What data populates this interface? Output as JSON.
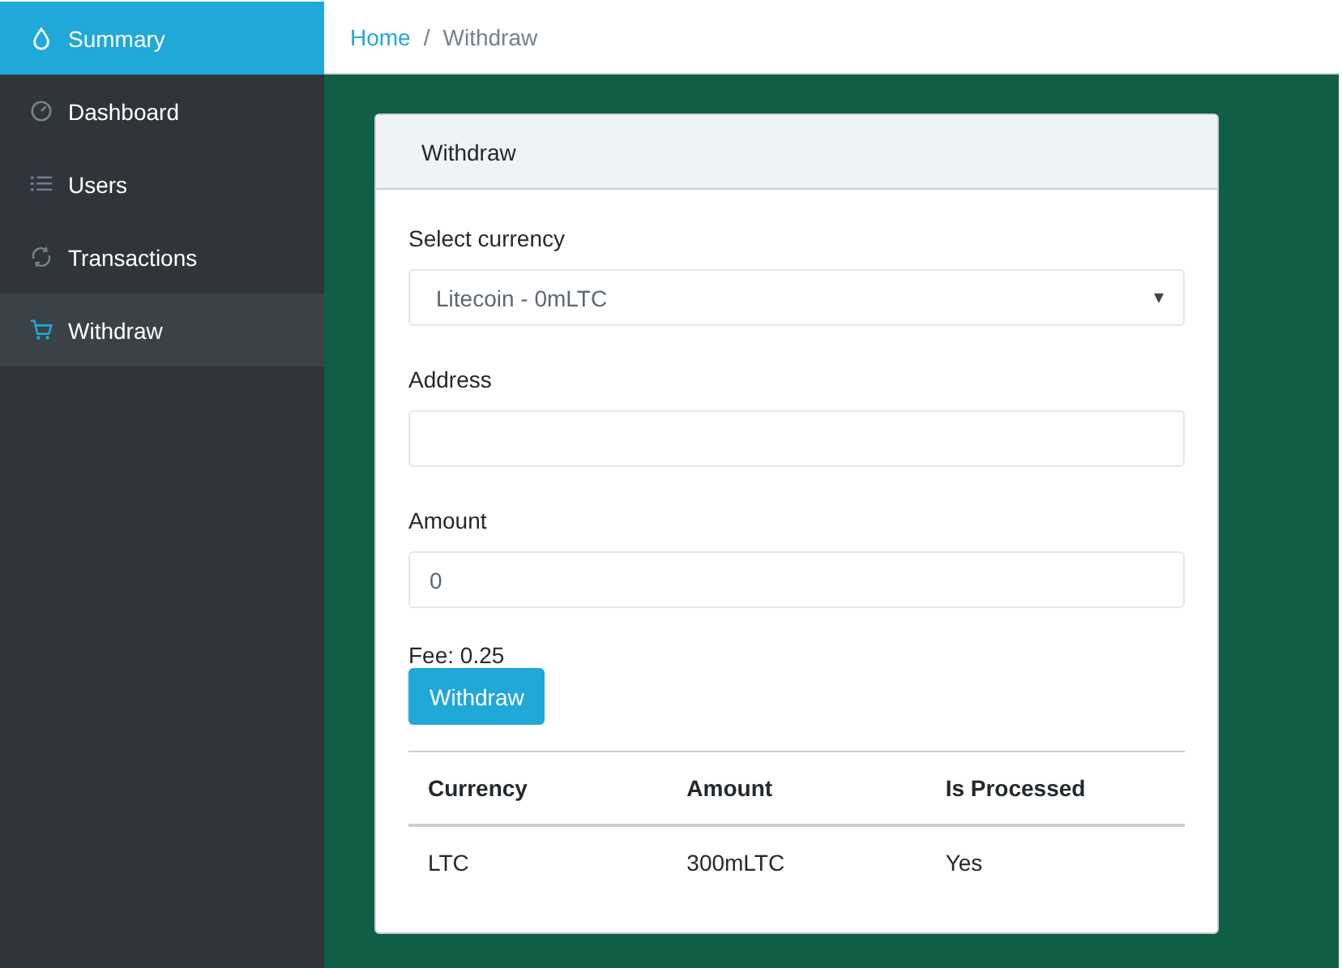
{
  "sidebar": {
    "items": [
      {
        "label": "Summary",
        "kind": "title",
        "selected": false
      },
      {
        "label": "Dashboard",
        "kind": "link",
        "selected": false
      },
      {
        "label": "Users",
        "kind": "link",
        "selected": false
      },
      {
        "label": "Transactions",
        "kind": "link",
        "selected": false
      },
      {
        "label": "Withdraw",
        "kind": "link",
        "selected": true
      }
    ]
  },
  "breadcrumb": {
    "separator": "/",
    "items": [
      {
        "label": "Home",
        "kind": "link"
      },
      {
        "label": "Withdraw",
        "kind": "current"
      }
    ]
  },
  "card": {
    "title": "Withdraw",
    "currency": {
      "label": "Select currency",
      "value": "Litecoin - 0mLTC"
    },
    "address": {
      "label": "Address"
    },
    "amount": {
      "label": "Amount",
      "value": "0"
    },
    "fee": "Fee: 0.25",
    "button": "Withdraw",
    "table": {
      "columns": [
        "Currency",
        "Amount",
        "Is Processed"
      ],
      "rows": [
        [
          "LTC",
          "300mLTC",
          "Yes"
        ]
      ]
    }
  }
}
